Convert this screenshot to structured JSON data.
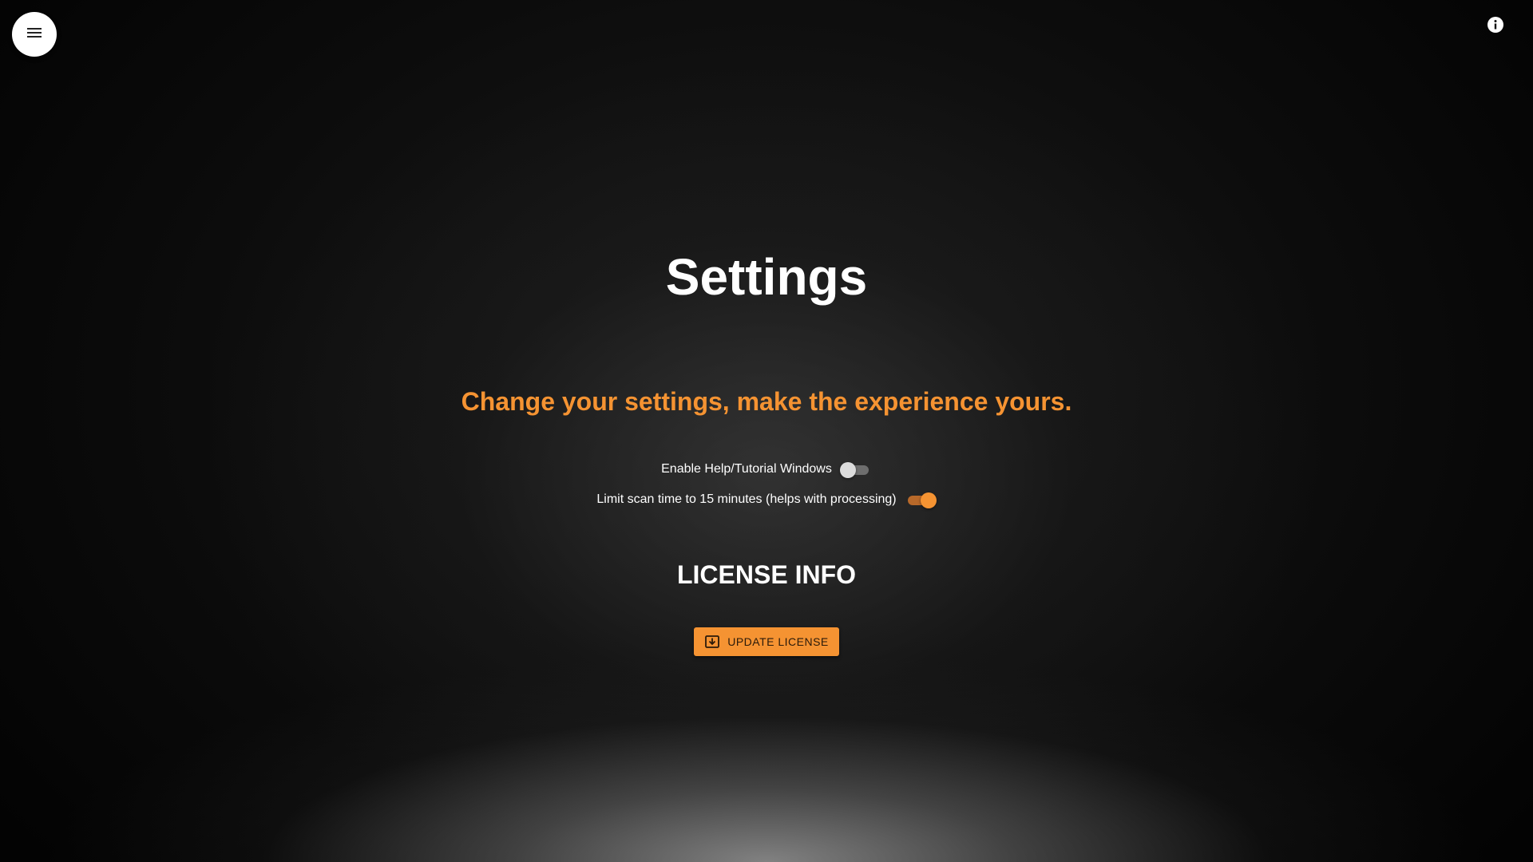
{
  "header": {
    "menu_icon": "hamburger-menu-icon",
    "info_icon": "info-icon"
  },
  "main": {
    "title": "Settings",
    "subtitle": "Change your settings, make the experience yours.",
    "settings": [
      {
        "label": "Enable Help/Tutorial Windows",
        "enabled": false
      },
      {
        "label": "Limit scan time to 15 minutes (helps with processing)",
        "enabled": true
      }
    ],
    "license": {
      "heading": "LICENSE INFO",
      "button_label": "UPDATE LICENSE",
      "button_icon": "download-box-icon"
    }
  },
  "colors": {
    "accent": "#f59332",
    "text": "#ffffff",
    "background": "#0c0c0c"
  }
}
